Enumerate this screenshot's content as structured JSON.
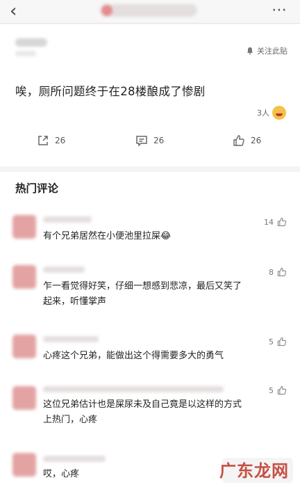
{
  "header": {
    "back_icon": "chevron-left-icon",
    "more_icon": "more-dots-icon"
  },
  "post": {
    "follow_label": "关注此贴",
    "text": "唉，厕所问题终于在28楼酿成了惨剧",
    "liker_count": "3人",
    "actions": [
      {
        "icon": "share-icon",
        "count": "26"
      },
      {
        "icon": "comment-icon",
        "count": "26"
      },
      {
        "icon": "thumbs-up-icon",
        "count": "26"
      }
    ]
  },
  "hot": {
    "title": "热门评论",
    "comments": [
      {
        "likes": "14",
        "lines": [
          "有个兄弟居然在小便池里拉屎😂"
        ]
      },
      {
        "likes": "8",
        "lines": [
          "乍一看觉得好笑，仔细一想感到悲凉，最后又笑了",
          "起来，听懂掌声"
        ]
      },
      {
        "likes": "5",
        "lines": [
          "心疼这个兄弟，能做出这个得需要多大的勇气"
        ]
      },
      {
        "likes": "5",
        "lines": [
          "这位兄弟估计也是屎尿未及自己竟是以这样的方式",
          "上热门，心疼"
        ]
      },
      {
        "likes": "",
        "lines": [
          "哎，心疼"
        ]
      }
    ]
  },
  "watermark": "广东龙网"
}
